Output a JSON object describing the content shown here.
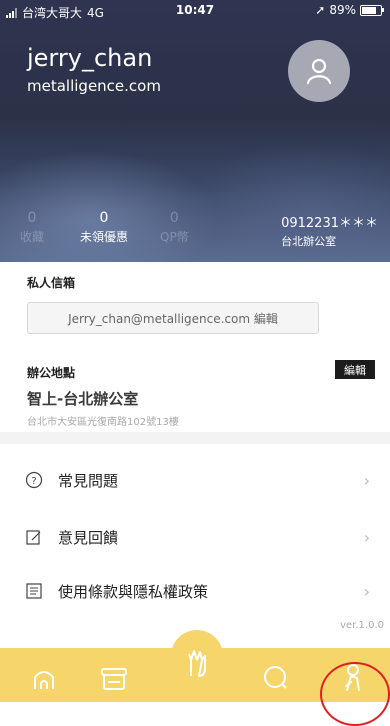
{
  "status_bar": {
    "carrier": "台湾大哥大",
    "network": "4G",
    "time": "10:47",
    "battery": "89%",
    "battery_fraction": 0.89
  },
  "profile": {
    "username": "jerry_chan",
    "company": "metalligence.com"
  },
  "stats": [
    {
      "value": "0",
      "label": "收藏"
    },
    {
      "value": "0",
      "label": "未領優惠"
    },
    {
      "value": "0",
      "label": "QP幣"
    }
  ],
  "contact": {
    "phone": "0912231＊＊＊",
    "office": "台北辦公室"
  },
  "email_section": {
    "label": "私人信箱",
    "value": "Jerry_chan@metalligence.com 編輯"
  },
  "office_section": {
    "label": "辦公地點",
    "edit_label": "編輯",
    "name": "智上-台北辦公室",
    "address": "台北市大安區光復南路102號13樓"
  },
  "menu": [
    {
      "label": "常見問題",
      "icon": "question-icon"
    },
    {
      "label": "意見回饋",
      "icon": "edit-icon"
    },
    {
      "label": "使用條款與隱私權政策",
      "icon": "document-icon"
    }
  ],
  "version": "ver.1.0.0",
  "tabs": [
    {
      "name": "home",
      "icon": "home-icon"
    },
    {
      "name": "store",
      "icon": "store-icon"
    },
    {
      "name": "deals",
      "icon": "hand-icon"
    },
    {
      "name": "search",
      "icon": "search-icon"
    },
    {
      "name": "profile",
      "icon": "person-icon",
      "active": true
    }
  ],
  "colors": {
    "header": "#2f3451",
    "tabbar": "#f6d56b",
    "highlight": "#e02020",
    "edit_button": "#1c1c1c"
  }
}
